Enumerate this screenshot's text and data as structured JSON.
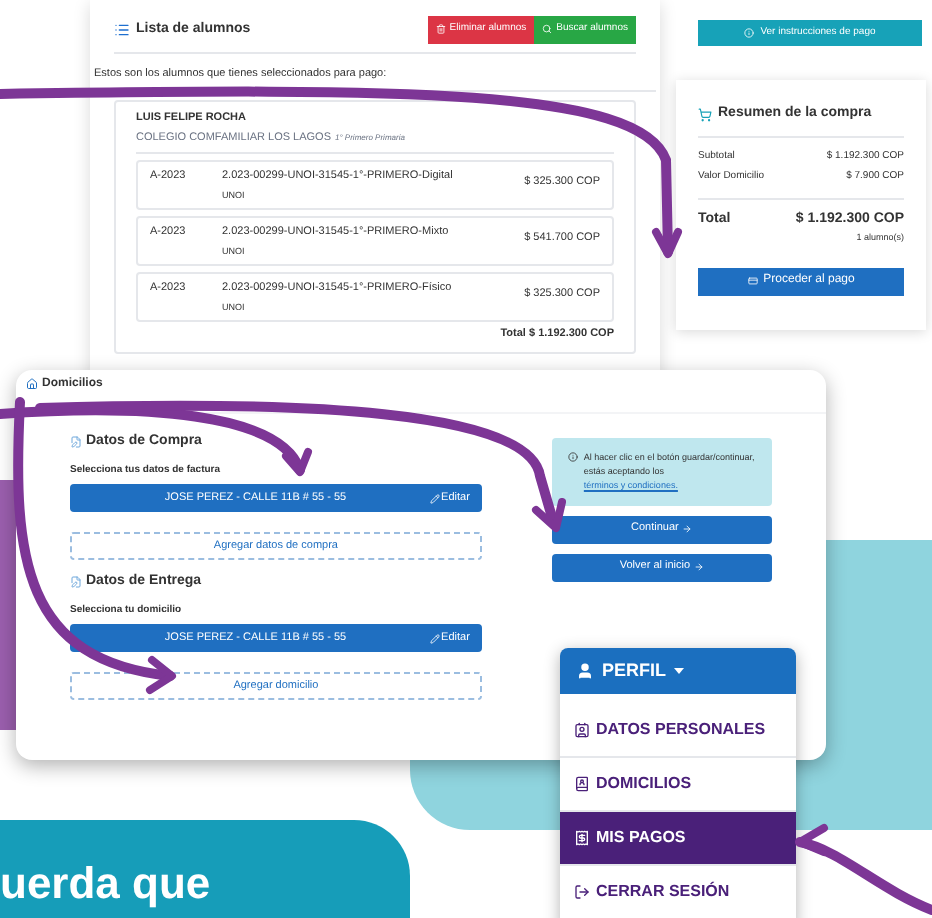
{
  "students_window": {
    "title": "Lista de alumnos",
    "buttons": [
      {
        "label": "Eliminar alumnos",
        "kind": "danger"
      },
      {
        "label": "Buscar alumnos",
        "kind": "success"
      }
    ],
    "intro": "Estos son los alumnos que tienes seleccionados para pago:",
    "student": {
      "name": "LUIS FELIPE ROCHA",
      "school": "COLEGIO COMFAMILIAR LOS LAGOS",
      "grade": "1° Primero Primaria"
    },
    "items": [
      {
        "code": "A-2023",
        "product": "2.023-00299-UNOI-31545-1°-PRIMERO-Digital",
        "brand": "UNOI",
        "price": "$ 325.300 COP"
      },
      {
        "code": "A-2023",
        "product": "2.023-00299-UNOI-31545-1°-PRIMERO-Mixto",
        "brand": "UNOI",
        "price": "$ 541.700 COP"
      },
      {
        "code": "A-2023",
        "product": "2.023-00299-UNOI-31545-1°-PRIMERO-Físico",
        "brand": "UNOI",
        "price": "$ 325.300 COP"
      }
    ],
    "total": "Total $ 1.192.300 COP"
  },
  "summary": {
    "instructions_button": "Ver instrucciones de pago",
    "title": "Resumen de la compra",
    "rows": [
      {
        "label": "Subtotal",
        "value": "$ 1.192.300 COP"
      },
      {
        "label": "Valor Domicilio",
        "value": "$ 7.900 COP"
      }
    ],
    "total_label": "Total",
    "total_value": "$ 1.192.300 COP",
    "students_count": "1 alumno(s)",
    "pay_button": "Proceder al pago"
  },
  "addresses_window": {
    "title": "Domicilios",
    "sections": [
      {
        "heading": "Datos de Compra",
        "prompt": "Selecciona tus datos de factura",
        "selected": "JOSE PEREZ - CALLE 11B # 55 - 55",
        "edit": "Editar",
        "add": "Agregar datos de compra"
      },
      {
        "heading": "Datos de Entrega",
        "prompt": "Selecciona tu domicilio",
        "selected": "JOSE PEREZ - CALLE 11B # 55 - 55",
        "edit": "Editar",
        "add": "Agregar domicilio"
      }
    ],
    "notice": "Al hacer clic en el botón guardar/continuar, estás aceptando los",
    "notice_link": "términos y condiciones.",
    "continue": "Continuar",
    "back": "Volver al inicio"
  },
  "profile_menu": {
    "title": "PERFIL",
    "items": [
      {
        "label": "DATOS PERSONALES",
        "kind": "profile",
        "selected": false
      },
      {
        "label": "DOMICILIOS",
        "kind": "addresses",
        "selected": false
      },
      {
        "label": "MIS PAGOS",
        "kind": "payments",
        "selected": true
      },
      {
        "label": "CERRAR SESIÓN",
        "kind": "logout",
        "selected": false
      }
    ]
  },
  "banner": {
    "text": "uerda que"
  }
}
